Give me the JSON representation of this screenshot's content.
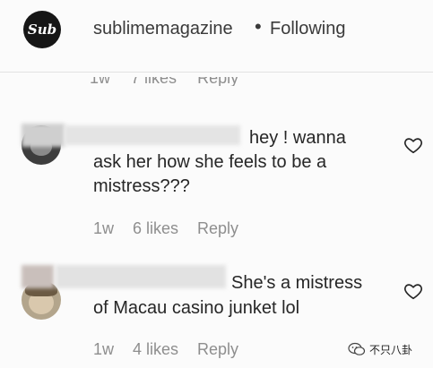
{
  "header": {
    "logo_text": "Sub",
    "username": "sublimemagazine",
    "separator": "•",
    "follow_status": "Following"
  },
  "previous_comment_meta": {
    "time": "1w",
    "likes": "7 likes",
    "reply": "Reply"
  },
  "comments": [
    {
      "line1": "hey ! wanna",
      "line2": "ask her how she feels to be a",
      "line3": "mistress???",
      "time": "1w",
      "likes": "6 likes",
      "reply": "Reply"
    },
    {
      "line1": "She's a mistress",
      "line2": "of Macau casino junket lol",
      "time": "1w",
      "likes": "4 likes",
      "reply": "Reply"
    }
  ],
  "watermark": {
    "text": "不只八卦"
  },
  "icons": {
    "heart": "heart-outline-icon",
    "watermark": "wechat-icon"
  }
}
